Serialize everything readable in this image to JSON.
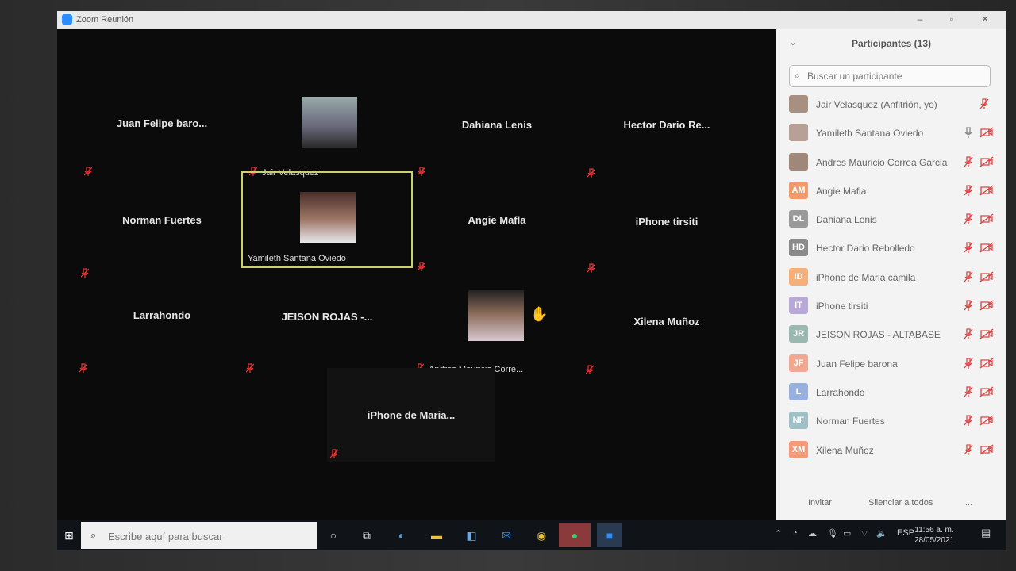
{
  "window": {
    "title": "Zoom Reunión"
  },
  "tiles": [
    {
      "name": "Juan Felipe baro..."
    },
    {
      "name": "Jair Velasquez"
    },
    {
      "name": "Dahiana Lenis"
    },
    {
      "name": "Hector Dario Re..."
    },
    {
      "name": "Norman Fuertes"
    },
    {
      "name": "Yamileth Santana Oviedo"
    },
    {
      "name": "Angie Mafla"
    },
    {
      "name": "iPhone tirsiti"
    },
    {
      "name": "Larrahondo"
    },
    {
      "name": "JEISON ROJAS -..."
    },
    {
      "name": "Andres Mauricio Corre..."
    },
    {
      "name": "Xilena Muñoz"
    },
    {
      "name": "iPhone de Maria..."
    }
  ],
  "panel": {
    "title": "Participantes (13)",
    "search_placeholder": "Buscar un participante",
    "participants": [
      {
        "initials": "",
        "name": "Jair Velasquez (Anfitrión, yo)",
        "color": "#a89080"
      },
      {
        "initials": "",
        "name": "Yamileth Santana Oviedo",
        "color": "#b7a095"
      },
      {
        "initials": "",
        "name": "Andres Mauricio Correa Garcia",
        "color": "#a08878"
      },
      {
        "initials": "AM",
        "name": "Angie Mafla",
        "color": "#f29a6b"
      },
      {
        "initials": "DL",
        "name": "Dahiana Lenis",
        "color": "#9a9a9a"
      },
      {
        "initials": "HD",
        "name": "Hector Dario Rebolledo",
        "color": "#8a8a8a"
      },
      {
        "initials": "ID",
        "name": "iPhone de Maria camila",
        "color": "#f5b07a"
      },
      {
        "initials": "IT",
        "name": "iPhone tirsiti",
        "color": "#b8a8d8"
      },
      {
        "initials": "JR",
        "name": "JEISON ROJAS - ALTABASE",
        "color": "#9ab8b0"
      },
      {
        "initials": "JF",
        "name": "Juan Felipe barona",
        "color": "#f0a890"
      },
      {
        "initials": "L",
        "name": "Larrahondo",
        "color": "#98b0e0"
      },
      {
        "initials": "NF",
        "name": "Norman Fuertes",
        "color": "#a0c0c8"
      },
      {
        "initials": "XM",
        "name": "Xilena Muñoz",
        "color": "#f59a78"
      }
    ],
    "invite_label": "Invitar",
    "mute_all_label": "Silenciar a todos",
    "more_label": "..."
  },
  "taskbar": {
    "search_placeholder": "Escribe aquí para buscar",
    "language": "ESP",
    "time": "11:56 a. m.",
    "date": "28/05/2021"
  }
}
